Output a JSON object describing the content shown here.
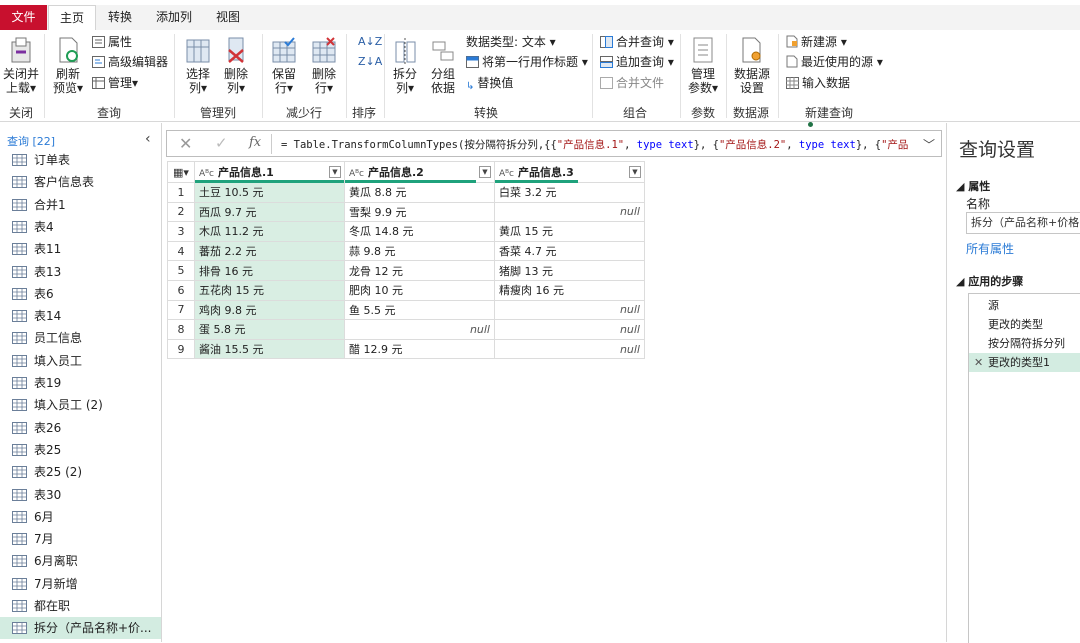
{
  "tabs": {
    "file": "文件",
    "home": "主页",
    "transform": "转换",
    "add_column": "添加列",
    "view": "视图"
  },
  "ribbon": {
    "close_load": [
      "关闭并",
      "上载"
    ],
    "refresh": [
      "刷新",
      "预览"
    ],
    "properties": "属性",
    "advanced_editor": "高级编辑器",
    "manage": "管理",
    "choose_cols": [
      "选择",
      "列"
    ],
    "remove_cols": [
      "删除",
      "列"
    ],
    "keep_rows": [
      "保留",
      "行"
    ],
    "remove_rows": [
      "删除",
      "行"
    ],
    "split_col": [
      "拆分",
      "列"
    ],
    "group_by": [
      "分组",
      "依据"
    ],
    "data_type": "数据类型: 文本",
    "first_row_header": "将第一行用作标题",
    "replace_values": "替换值",
    "merge_queries": "合并查询",
    "append_queries": "追加查询",
    "combine_files": "合并文件",
    "manage_params": [
      "管理",
      "参数"
    ],
    "ds_settings": [
      "数据源",
      "设置"
    ],
    "new_source": "新建源",
    "recent_sources": "最近使用的源",
    "enter_data": "输入数据",
    "groups": {
      "close": "关闭",
      "query": "查询",
      "manage_cols": "管理列",
      "reduce_rows": "减少行",
      "sort": "排序",
      "transform": "转换",
      "combine": "组合",
      "params": "参数",
      "datasource": "数据源",
      "new_query": "新建查询"
    }
  },
  "queries": {
    "header": "查询 [22]",
    "items": [
      "订单表",
      "客户信息表",
      "合并1",
      "表4",
      "表11",
      "表13",
      "表6",
      "表14",
      "员工信息",
      "填入员工",
      "表19",
      "填入员工 (2)",
      "表26",
      "表25",
      "表25 (2)",
      "表30",
      "6月",
      "7月",
      "6月离职",
      "7月新增",
      "都在职",
      "拆分（产品名称+价..."
    ]
  },
  "formula": {
    "p1": "= Table.TransformColumnTypes(按分隔符拆分列,{{",
    "s1": "\"产品信息.1\"",
    "p2": ", ",
    "k1": "type text",
    "p3": "}, {",
    "s2": "\"产品信息.2\"",
    "p4": ", ",
    "k2": "type text",
    "p5": "}, {",
    "s3": "\"产品"
  },
  "table": {
    "type_label": "Aᴮᴄ",
    "headers": [
      "产品信息.1",
      "产品信息.2",
      "产品信息.3"
    ],
    "rows": [
      [
        "1",
        "土豆 10.5 元",
        "黄瓜 8.8 元",
        "白菜 3.2 元"
      ],
      [
        "2",
        "西瓜 9.7 元",
        "雪梨 9.9 元",
        "null"
      ],
      [
        "3",
        "木瓜 11.2 元",
        "冬瓜 14.8 元",
        "黄瓜 15 元"
      ],
      [
        "4",
        "蕃茄 2.2 元",
        "蒜 9.8 元",
        "香菜 4.7 元"
      ],
      [
        "5",
        "排骨 16 元",
        "龙骨 12 元",
        "猪脚 13 元"
      ],
      [
        "6",
        "五花肉 15 元",
        "肥肉 10 元",
        "精瘦肉 16 元"
      ],
      [
        "7",
        "鸡肉 9.8 元",
        "鱼 5.5 元",
        "null"
      ],
      [
        "8",
        "蛋 5.8 元",
        "null",
        "null"
      ],
      [
        "9",
        "酱油 15.5 元",
        "醋 12.9 元",
        "null"
      ]
    ]
  },
  "settings": {
    "title": "查询设置",
    "props_section": "属性",
    "name_label": "名称",
    "name_value": "拆分（产品名称+价格",
    "all_props": "所有属性",
    "steps_section": "应用的步骤",
    "steps": [
      "源",
      "更改的类型",
      "按分隔符拆分列",
      "更改的类型1"
    ]
  }
}
